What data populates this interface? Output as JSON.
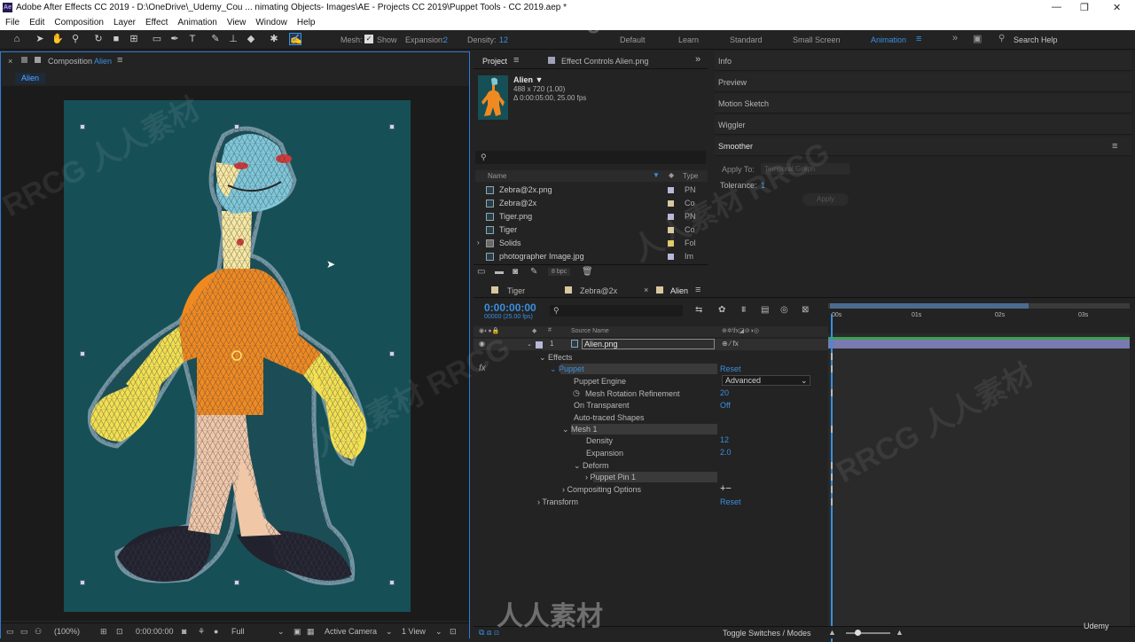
{
  "window": {
    "title": "Adobe After Effects CC 2019 - D:\\OneDrive\\_Udemy_Cou ... nimating Objects- Images\\AE - Projects CC 2019\\Puppet Tools - CC 2019.aep *",
    "app_icon": "Ae",
    "minimize": "—",
    "maximize": "❐",
    "close": "✕"
  },
  "menu": [
    "File",
    "Edit",
    "Composition",
    "Layer",
    "Effect",
    "Animation",
    "View",
    "Window",
    "Help"
  ],
  "toolbar": {
    "mesh_label": "Mesh:",
    "show_label": "Show",
    "expansion_label": "Expansion:",
    "expansion_value": "2",
    "density_label": "Density:",
    "density_value": "12",
    "workspaces": [
      "Default",
      "Learn",
      "Standard",
      "Small Screen",
      "Animation"
    ],
    "search_help": "Search Help"
  },
  "comp_panel": {
    "header_label": "Composition",
    "comp_name": "Alien",
    "tab": "Alien",
    "footer": {
      "zoom": "(100%)",
      "time": "0:00:00:00",
      "resolution": "Full",
      "camera": "Active Camera",
      "views": "1 View"
    }
  },
  "project_panel": {
    "tab_project": "Project",
    "tab_effect_controls": "Effect Controls Alien.png",
    "selected_name": "Alien ▼",
    "selected_dims": "488 x 720 (1.00)",
    "selected_duration": "Δ 0:00:05:00, 25.00 fps",
    "search_placeholder": "",
    "col_name": "Name",
    "col_type": "Type",
    "items": [
      {
        "name": "Zebra@2x.png",
        "type": "PN",
        "color": "#b8b8d8"
      },
      {
        "name": "Zebra@2x",
        "type": "Co",
        "color": "#d8c8a0"
      },
      {
        "name": "Tiger.png",
        "type": "PN",
        "color": "#b8b8d8"
      },
      {
        "name": "Tiger",
        "type": "Co",
        "color": "#d8c8a0"
      },
      {
        "name": "Solids",
        "type": "Fol",
        "color": "#e0c860"
      },
      {
        "name": "photographer Image.jpg",
        "type": "Im",
        "color": "#b8b8d8"
      }
    ],
    "bpc": "8 bpc"
  },
  "right_panels": {
    "items": [
      "Info",
      "Preview",
      "Motion Sketch",
      "Wiggler",
      "Smoother"
    ],
    "apply_to_label": "Apply To:",
    "apply_to_value": "Temporal Graph",
    "tolerance_label": "Tolerance:",
    "tolerance_value": "1",
    "apply_button": "Apply"
  },
  "timeline": {
    "tabs": [
      "Tiger",
      "Zebra@2x",
      "Alien"
    ],
    "timecode": "0:00:00:00",
    "fps_sub": "00000 (25.00 fps)",
    "col_source": "Source Name",
    "layer_num": "1",
    "layer_name": "Alien.png",
    "effects_label": "Effects",
    "puppet_label": "Puppet",
    "reset": "Reset",
    "puppet_engine_label": "Puppet Engine",
    "puppet_engine_value": "Advanced",
    "mesh_rotation_label": "Mesh Rotation Refinement",
    "mesh_rotation_value": "20",
    "on_transparent_label": "On Transparent",
    "on_transparent_value": "Off",
    "auto_traced_label": "Auto-traced Shapes",
    "mesh1_label": "Mesh 1",
    "density_label": "Density",
    "density_value": "12",
    "expansion_label": "Expansion",
    "expansion_value": "2.0",
    "deform_label": "Deform",
    "pin_label": "Puppet Pin 1",
    "compositing_label": "Compositing Options",
    "add_remove": "+−",
    "transform_label": "Transform",
    "ruler_ticks": [
      "00s",
      "01s",
      "02s",
      "03s"
    ],
    "toggle_label": "Toggle Switches / Modes"
  }
}
